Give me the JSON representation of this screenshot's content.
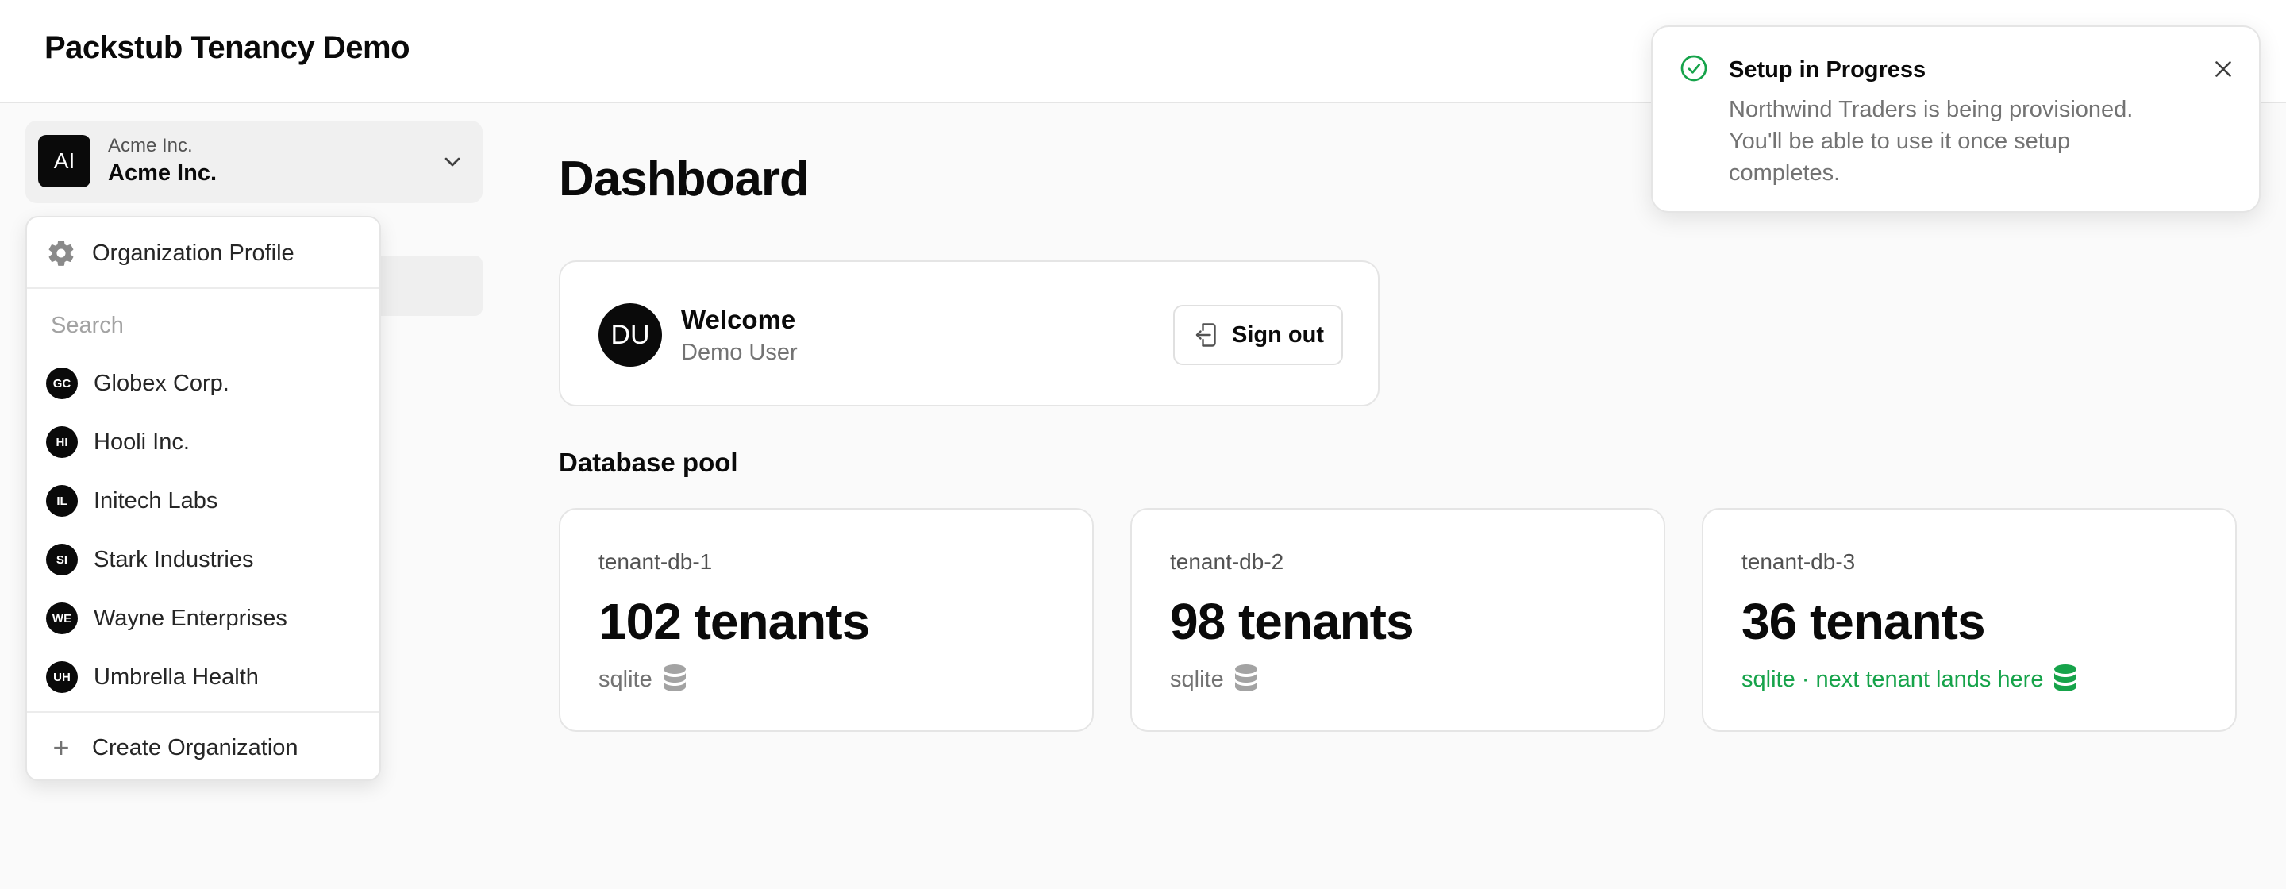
{
  "app": {
    "title": "Packstub Tenancy Demo"
  },
  "org_switcher": {
    "avatar_initials": "AI",
    "small_label": "Acme Inc.",
    "name": "Acme Inc."
  },
  "org_dropdown": {
    "profile_label": "Organization Profile",
    "search_placeholder": "Search",
    "orgs": [
      {
        "initials": "GC",
        "name": "Globex Corp."
      },
      {
        "initials": "HI",
        "name": "Hooli Inc."
      },
      {
        "initials": "IL",
        "name": "Initech Labs"
      },
      {
        "initials": "SI",
        "name": "Stark Industries"
      },
      {
        "initials": "WE",
        "name": "Wayne Enterprises"
      },
      {
        "initials": "UH",
        "name": "Umbrella Health"
      }
    ],
    "create_label": "Create Organization"
  },
  "main": {
    "page_title": "Dashboard",
    "welcome": {
      "avatar_initials": "DU",
      "title": "Welcome",
      "subtitle": "Demo User",
      "signout_label": "Sign out"
    },
    "pool": {
      "title": "Database pool",
      "databases": [
        {
          "name": "tenant-db-1",
          "count": "102 tenants",
          "engine": "sqlite"
        },
        {
          "name": "tenant-db-2",
          "count": "98 tenants",
          "engine": "sqlite"
        },
        {
          "name": "tenant-db-3",
          "count": "36 tenants",
          "engine": "sqlite · next tenant lands here"
        }
      ]
    }
  },
  "toast": {
    "title": "Setup in Progress",
    "description": "Northwind Traders is being provisioned. You'll be able to use it once setup completes."
  },
  "colors": {
    "accent_green": "#16a34a",
    "primary": "#0a0a0a",
    "muted": "#737373"
  }
}
